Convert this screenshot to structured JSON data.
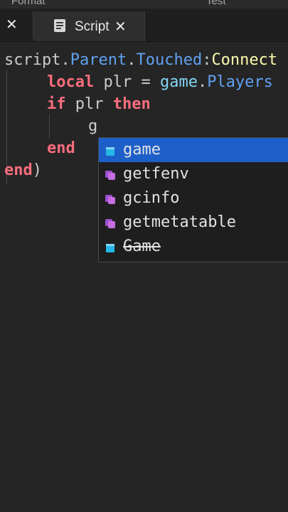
{
  "menubar": {
    "format_label": "Format",
    "test_label": "Test"
  },
  "tabs": {
    "previous_close": "✕",
    "active": {
      "label": "Script",
      "close": "✕"
    }
  },
  "code": {
    "line1": {
      "obj": "script",
      "d1": ".",
      "p1": "Parent",
      "d2": ".",
      "p2": "Touched",
      "colon": ":",
      "method": "Connect"
    },
    "line2": {
      "kw": "local",
      "rest": " plr = ",
      "game": "game",
      "dot": ".",
      "prop": "Players"
    },
    "line3": {
      "kw1": "if",
      "mid": " plr ",
      "kw2": "then"
    },
    "line4": {
      "typed": "g"
    },
    "line5": {
      "kw": "end"
    },
    "line6": {
      "kw": "end",
      "paren": ")"
    }
  },
  "autocomplete": {
    "items": [
      {
        "label": "game",
        "icon": "cube-icon",
        "selected": true,
        "deprecated": false
      },
      {
        "label": "getfenv",
        "icon": "function-icon",
        "selected": false,
        "deprecated": false
      },
      {
        "label": "gcinfo",
        "icon": "function-icon",
        "selected": false,
        "deprecated": false
      },
      {
        "label": "getmetatable",
        "icon": "function-icon",
        "selected": false,
        "deprecated": false
      },
      {
        "label": "Game",
        "icon": "cube-icon",
        "selected": false,
        "deprecated": true
      }
    ]
  },
  "colors": {
    "background": "#252525",
    "keyword": "#f86d7c",
    "property": "#61a1f1",
    "builtin": "#84d6f7",
    "selection": "#1d5fc9",
    "function_icon": "#c46ee0",
    "cube_icon": "#25b7e5"
  }
}
